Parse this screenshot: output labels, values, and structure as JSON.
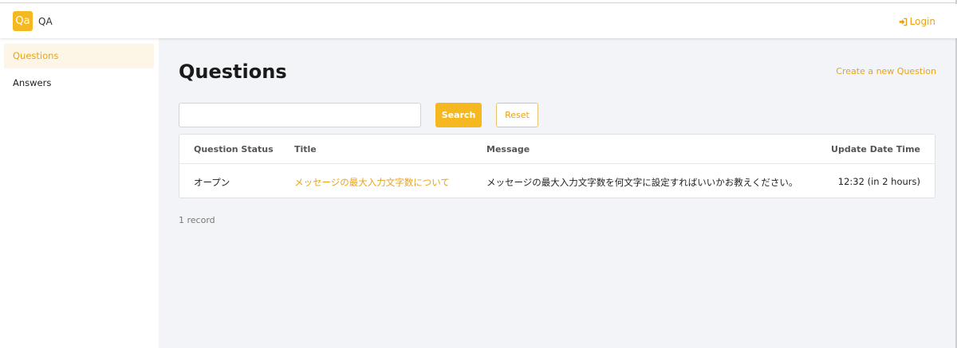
{
  "header": {
    "logo_text": "Qa",
    "app_name": "QA",
    "login_label": "Login",
    "accent_color": "#f5b820"
  },
  "sidebar": {
    "items": [
      {
        "label": "Questions",
        "active": true
      },
      {
        "label": "Answers",
        "active": false
      }
    ]
  },
  "main": {
    "title": "Questions",
    "create_link": "Create a new Question",
    "search": {
      "value": "",
      "placeholder": ""
    },
    "search_button": "Search",
    "reset_button": "Reset",
    "table": {
      "columns": [
        "Question Status",
        "Title",
        "Message",
        "Update Date Time"
      ],
      "rows": [
        {
          "status": "オープン",
          "title": "メッセージの最大入力文字数について",
          "message": "メッセージの最大入力文字数を何文字に設定すればいいかお教えください。",
          "updated": "12:32 (in 2 hours)"
        }
      ]
    },
    "record_count": "1 record"
  }
}
